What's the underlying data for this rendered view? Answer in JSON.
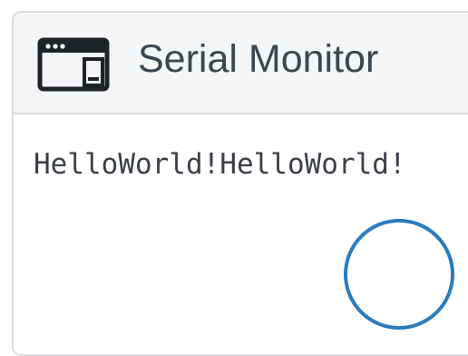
{
  "panel": {
    "title": "Serial Monitor",
    "icon": "serial-monitor-window-icon"
  },
  "output": {
    "text": "HelloWorld!HelloWorld!"
  },
  "spinner": {
    "icon": "loading-circle-icon",
    "color": "#2b7bbf"
  },
  "colors": {
    "header_bg": "#f4f5f7",
    "border": "#dcdde0",
    "title_text": "#3c4650",
    "output_text": "#3a3f48"
  }
}
